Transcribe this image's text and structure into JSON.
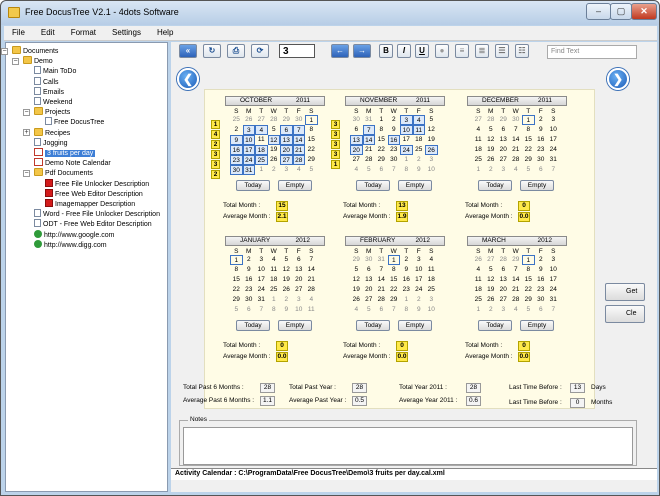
{
  "window": {
    "title": "Free DocusTree V2.1 - 4dots Software",
    "min": "–",
    "max": "▢",
    "close": "✕"
  },
  "menu": [
    "File",
    "Edit",
    "Format",
    "Settings",
    "Help"
  ],
  "tree": [
    {
      "label": "Documents",
      "icon": "folder",
      "lvl": 0,
      "exp": "−"
    },
    {
      "label": "Demo",
      "icon": "folder",
      "lvl": 1,
      "exp": "−"
    },
    {
      "label": "Main ToDo",
      "icon": "doc",
      "lvl": 2
    },
    {
      "label": "Calls",
      "icon": "doc",
      "lvl": 2
    },
    {
      "label": "Emails",
      "icon": "doc",
      "lvl": 2
    },
    {
      "label": "Weekend",
      "icon": "doc",
      "lvl": 2
    },
    {
      "label": "Projects",
      "icon": "folder",
      "lvl": 2,
      "exp": "−"
    },
    {
      "label": "Free DocusTree",
      "icon": "doc",
      "lvl": 3
    },
    {
      "label": "Recipes",
      "icon": "folder",
      "lvl": 2,
      "exp": "+"
    },
    {
      "label": "Jogging",
      "icon": "doc",
      "lvl": 2
    },
    {
      "label": "3 fruits per day",
      "icon": "cal",
      "lvl": 2,
      "sel": true
    },
    {
      "label": "Demo Note Calendar",
      "icon": "cal",
      "lvl": 2
    },
    {
      "label": "Pdf Documents",
      "icon": "folder",
      "lvl": 2,
      "exp": "−"
    },
    {
      "label": "Free File Unlocker Description",
      "icon": "pdf",
      "lvl": 3
    },
    {
      "label": "Free Web Editor Description",
      "icon": "pdf",
      "lvl": 3
    },
    {
      "label": "Imagemapper Description",
      "icon": "pdf",
      "lvl": 3
    },
    {
      "label": "Word - Free File Unlocker Description",
      "icon": "doc",
      "lvl": 2
    },
    {
      "label": "ODT - Free Web Editor Description",
      "icon": "doc",
      "lvl": 2
    },
    {
      "label": "http://www.google.com",
      "icon": "globe",
      "lvl": 2
    },
    {
      "label": "http://www.digg.com",
      "icon": "globe",
      "lvl": 2
    }
  ],
  "toolbar": {
    "number": "3",
    "find_placeholder": "Find Text",
    "bold": "B",
    "italic": "I",
    "underline": "U",
    "icons": [
      "back-arrow",
      "refresh",
      "print",
      "reload"
    ]
  },
  "nav": {
    "prev": "❮",
    "next": "❯"
  },
  "dow": [
    "S",
    "M",
    "T",
    "W",
    "T",
    "F",
    "S"
  ],
  "labels": {
    "today": "Today",
    "empty": "Empty",
    "total_month": "Total Month :",
    "avg_month": "Average Month :"
  },
  "months": [
    {
      "name": "OCTOBER",
      "year": "2011",
      "lead": [
        25,
        26,
        27,
        28,
        29,
        30
      ],
      "days": 31,
      "trail": [
        1,
        2,
        3,
        4,
        5
      ],
      "hl": [
        3,
        4,
        6,
        7,
        9,
        10,
        12,
        13,
        14,
        16,
        17,
        18,
        20,
        21,
        23,
        24,
        25,
        27,
        28,
        30,
        31
      ],
      "today": [
        1
      ],
      "weeks": [
        "1",
        "4",
        "2",
        "3",
        "3",
        "2"
      ],
      "total": "15",
      "avg": "2.1"
    },
    {
      "name": "NOVEMBER",
      "year": "2011",
      "lead": [
        30,
        31
      ],
      "days": 30,
      "trail": [
        1,
        2,
        3,
        4,
        5,
        6,
        7,
        8,
        9,
        10
      ],
      "hl": [
        3,
        4,
        7,
        10,
        11,
        13,
        14,
        16,
        20,
        24,
        26
      ],
      "today": [],
      "weeks": [
        "3",
        "3",
        "3",
        "3",
        "1",
        ""
      ],
      "total": "13",
      "avg": "1.9"
    },
    {
      "name": "DECEMBER",
      "year": "2011",
      "lead": [
        27,
        28,
        29,
        30
      ],
      "days": 31,
      "trail": [
        1,
        2,
        3,
        4,
        5,
        6,
        7
      ],
      "hl": [],
      "today": [
        1
      ],
      "weeks": [],
      "total": "0",
      "avg": "0.0"
    },
    {
      "name": "JANUARY",
      "year": "2012",
      "lead": [],
      "days": 31,
      "trail": [
        1,
        2,
        3,
        4,
        5,
        6,
        7,
        8,
        9,
        10,
        11
      ],
      "hl": [],
      "today": [
        1
      ],
      "weeks": [],
      "total": "0",
      "avg": "0.0"
    },
    {
      "name": "FEBRUARY",
      "year": "2012",
      "lead": [
        29,
        30,
        31
      ],
      "days": 29,
      "trail": [
        1,
        2,
        3,
        4,
        5,
        6,
        7,
        8,
        9,
        10
      ],
      "hl": [],
      "today": [
        1
      ],
      "weeks": [],
      "total": "0",
      "avg": "0.0"
    },
    {
      "name": "MARCH",
      "year": "2012",
      "lead": [
        26,
        27,
        28,
        29
      ],
      "days": 31,
      "trail": [
        1,
        2,
        3,
        4,
        5,
        6,
        7
      ],
      "hl": [],
      "today": [
        1
      ],
      "weeks": [],
      "total": "0",
      "avg": "0.0"
    }
  ],
  "stats": {
    "total6": {
      "label": "Total Past 6 Months :",
      "value": "28"
    },
    "avg6": {
      "label": "Average Past 6 Months :",
      "value": "1.1"
    },
    "totalYear": {
      "label": "Total Past Year :",
      "value": "28"
    },
    "avgYear": {
      "label": "Average Past Year :",
      "value": "0.5"
    },
    "totalY2011": {
      "label": "Total Year 2011 :",
      "value": "28"
    },
    "avgY2011": {
      "label": "Average Year 2011 :",
      "value": "0.6"
    },
    "ltb1": {
      "label": "Last Time Before :",
      "value": "13",
      "unit": "Days"
    },
    "ltb2": {
      "label": "Last Time Before :",
      "value": "0",
      "unit": "Months"
    }
  },
  "notes": {
    "caption": "Notes"
  },
  "status": "Activity Calendar : C:\\ProgramData\\Free DocusTree\\Demo\\3 fruits per day.cal.xml",
  "side_buttons": [
    "Get",
    "Cle"
  ]
}
